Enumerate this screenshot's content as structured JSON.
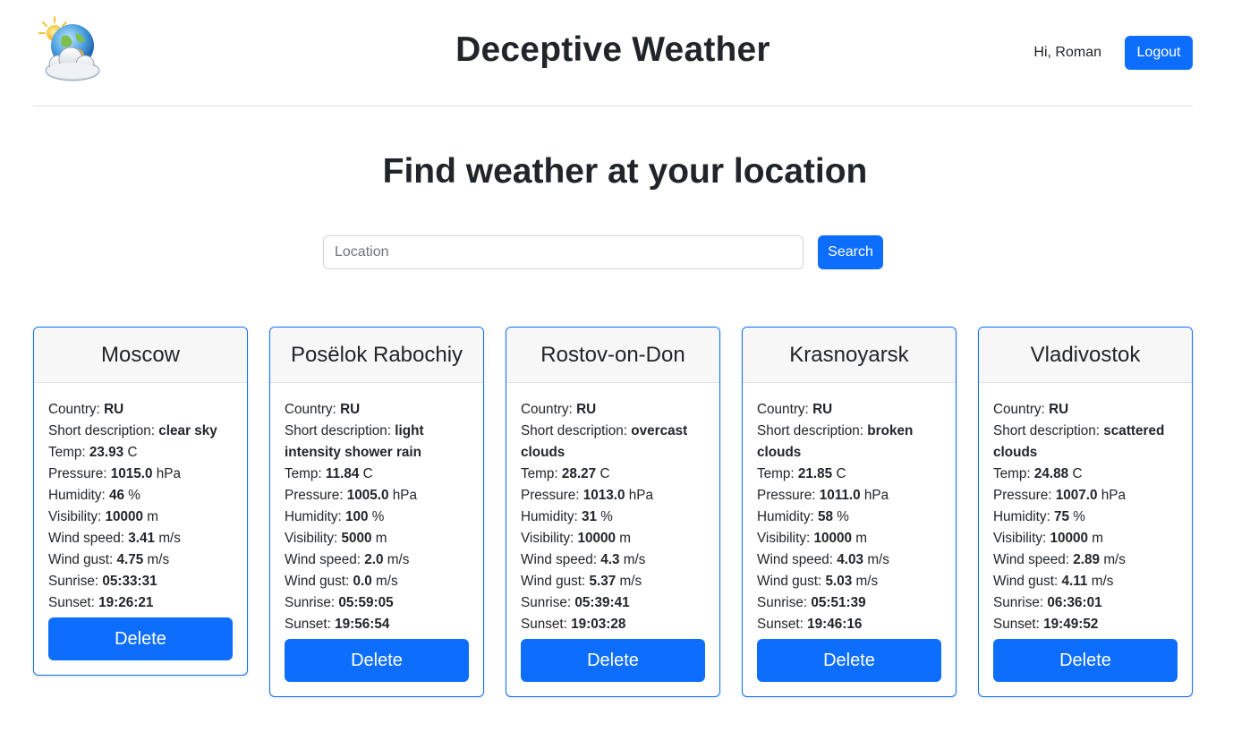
{
  "header": {
    "app_title": "Deceptive Weather",
    "greeting": "Hi, Roman",
    "logout_label": "Logout"
  },
  "main": {
    "title": "Find weather at your location",
    "search": {
      "placeholder": "Location",
      "value": "",
      "button_label": "Search"
    }
  },
  "labels": {
    "country": "Country:",
    "short_description": "Short description:",
    "temp": "Temp:",
    "pressure": "Pressure:",
    "humidity": "Humidity:",
    "visibility": "Visibility:",
    "wind_speed": "Wind speed:",
    "wind_gust": "Wind gust:",
    "sunrise": "Sunrise:",
    "sunset": "Sunset:",
    "delete": "Delete"
  },
  "cards": [
    {
      "city": "Moscow",
      "country": "RU",
      "description": "clear sky",
      "temp": "23.93",
      "temp_unit": "C",
      "pressure": "1015.0",
      "pressure_unit": "hPa",
      "humidity": "46",
      "humidity_unit": "%",
      "visibility": "10000",
      "visibility_unit": "m",
      "wind_speed": "3.41",
      "wind_speed_unit": "m/s",
      "wind_gust": "4.75",
      "wind_gust_unit": "m/s",
      "sunrise": "05:33:31",
      "sunset": "19:26:21"
    },
    {
      "city": "Posëlok Rabochiy",
      "country": "RU",
      "description": "light intensity shower rain",
      "temp": "11.84",
      "temp_unit": "C",
      "pressure": "1005.0",
      "pressure_unit": "hPa",
      "humidity": "100",
      "humidity_unit": "%",
      "visibility": "5000",
      "visibility_unit": "m",
      "wind_speed": "2.0",
      "wind_speed_unit": "m/s",
      "wind_gust": "0.0",
      "wind_gust_unit": "m/s",
      "sunrise": "05:59:05",
      "sunset": "19:56:54"
    },
    {
      "city": "Rostov-on-Don",
      "country": "RU",
      "description": "overcast clouds",
      "temp": "28.27",
      "temp_unit": "C",
      "pressure": "1013.0",
      "pressure_unit": "hPa",
      "humidity": "31",
      "humidity_unit": "%",
      "visibility": "10000",
      "visibility_unit": "m",
      "wind_speed": "4.3",
      "wind_speed_unit": "m/s",
      "wind_gust": "5.37",
      "wind_gust_unit": "m/s",
      "sunrise": "05:39:41",
      "sunset": "19:03:28"
    },
    {
      "city": "Krasnoyarsk",
      "country": "RU",
      "description": "broken clouds",
      "temp": "21.85",
      "temp_unit": "C",
      "pressure": "1011.0",
      "pressure_unit": "hPa",
      "humidity": "58",
      "humidity_unit": "%",
      "visibility": "10000",
      "visibility_unit": "m",
      "wind_speed": "4.03",
      "wind_speed_unit": "m/s",
      "wind_gust": "5.03",
      "wind_gust_unit": "m/s",
      "sunrise": "05:51:39",
      "sunset": "19:46:16"
    },
    {
      "city": "Vladivostok",
      "country": "RU",
      "description": "scattered clouds",
      "temp": "24.88",
      "temp_unit": "C",
      "pressure": "1007.0",
      "pressure_unit": "hPa",
      "humidity": "75",
      "humidity_unit": "%",
      "visibility": "10000",
      "visibility_unit": "m",
      "wind_speed": "2.89",
      "wind_speed_unit": "m/s",
      "wind_gust": "4.11",
      "wind_gust_unit": "m/s",
      "sunrise": "06:36:01",
      "sunset": "19:49:52"
    }
  ],
  "colors": {
    "primary": "#0d6efd",
    "text": "#212529",
    "card_header_bg": "#f7f7f7"
  },
  "icons": {
    "logo": "sun-behind-cloud-globe-icon"
  }
}
